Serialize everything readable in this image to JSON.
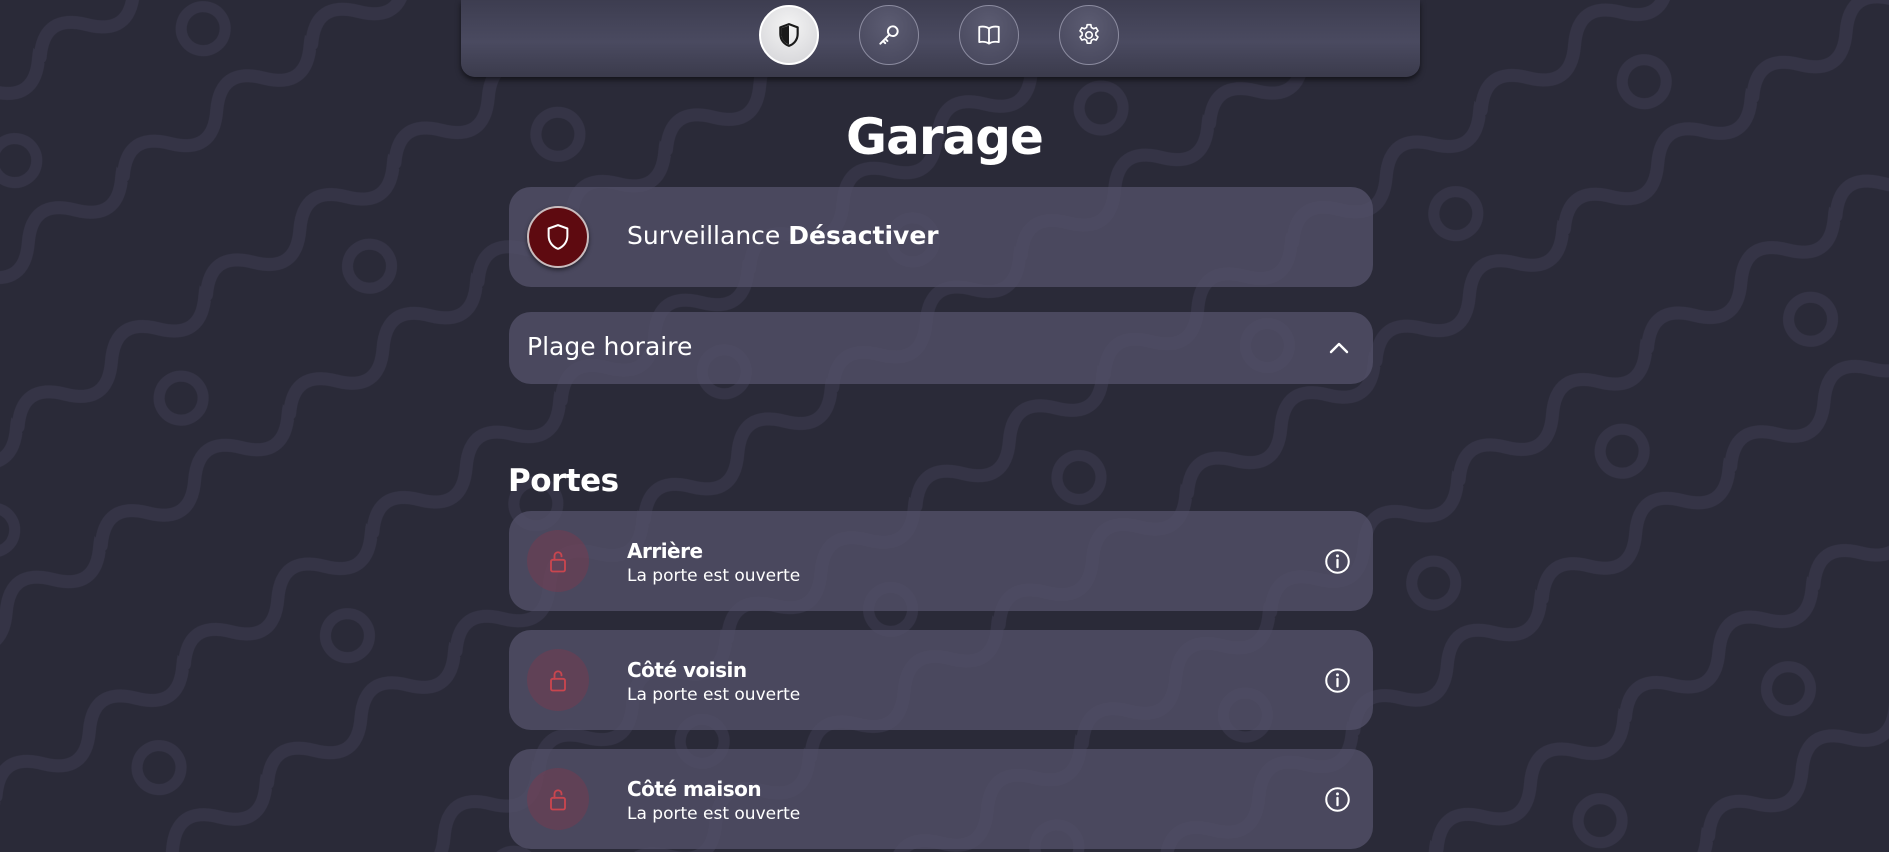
{
  "nav": {
    "items": [
      {
        "icon": "shield-icon",
        "active": true
      },
      {
        "icon": "key-icon",
        "active": false
      },
      {
        "icon": "book-icon",
        "active": false
      },
      {
        "icon": "gear-icon",
        "active": false
      }
    ]
  },
  "page": {
    "title": "Garage"
  },
  "surveillance": {
    "label": "Surveillance",
    "action": "Désactiver",
    "icon": "shield-icon",
    "icon_color": "#5e0a10"
  },
  "schedule": {
    "label": "Plage horaire",
    "icon": "chevron-up-icon"
  },
  "doors": {
    "title": "Portes",
    "items": [
      {
        "name": "Arrière",
        "status": "La porte est ouverte",
        "icon": "unlocked-padlock-icon"
      },
      {
        "name": "Côté voisin",
        "status": "La porte est ouverte",
        "icon": "unlocked-padlock-icon"
      },
      {
        "name": "Côté maison",
        "status": "La porte est ouverte",
        "icon": "unlocked-padlock-icon"
      }
    ]
  },
  "colors": {
    "background": "#2a2a38",
    "card": "#525068",
    "alert": "#c8464f",
    "text": "#ffffff"
  }
}
